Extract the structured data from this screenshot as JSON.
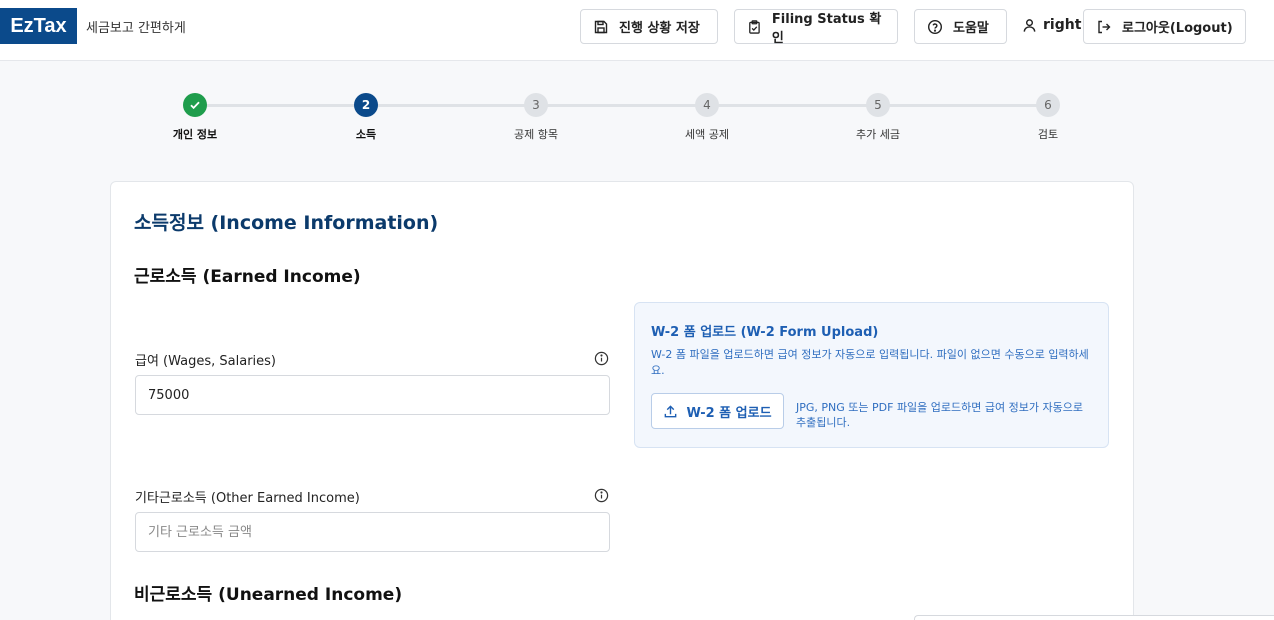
{
  "app": {
    "logo": "EzTax",
    "tagline": "세금보고 간편하게"
  },
  "header": {
    "save_label": "진행 상황 저장",
    "filing_status_label": "Filing Status 확인",
    "help_label": "도움말",
    "username": "right",
    "logout_label": "로그아웃(Logout)"
  },
  "stepper": {
    "steps": [
      {
        "number": "1",
        "label": "개인 정보",
        "state": "done"
      },
      {
        "number": "2",
        "label": "소득",
        "state": "active"
      },
      {
        "number": "3",
        "label": "공제 항목",
        "state": "todo"
      },
      {
        "number": "4",
        "label": "세액 공제",
        "state": "todo"
      },
      {
        "number": "5",
        "label": "추가 세금",
        "state": "todo"
      },
      {
        "number": "6",
        "label": "검토",
        "state": "todo"
      }
    ]
  },
  "form": {
    "title": "소득정보 (Income Information)",
    "earned_section": "근로소득 (Earned Income)",
    "wages_label": "급여 (Wages, Salaries)",
    "wages_value": "75000",
    "other_earned_label": "기타근로소득 (Other Earned Income)",
    "other_earned_placeholder": "기타 근로소득 금액",
    "unearned_section": "비근로소득 (Unearned Income)"
  },
  "upload": {
    "title": "W-2 폼 업로드 (W-2 Form Upload)",
    "description": "W-2 폼 파일을 업로드하면 급여 정보가 자동으로 입력됩니다. 파일이 없으면 수동으로 입력하세요.",
    "button_label": "W-2 폼 업로드",
    "note": "JPG, PNG 또는 PDF 파일을 업로드하면 급여 정보가 자동으로 추출됩니다."
  },
  "colors": {
    "brand": "#0b4a8b",
    "done": "#1f9d4c",
    "accent_blue": "#1e5fb3"
  }
}
